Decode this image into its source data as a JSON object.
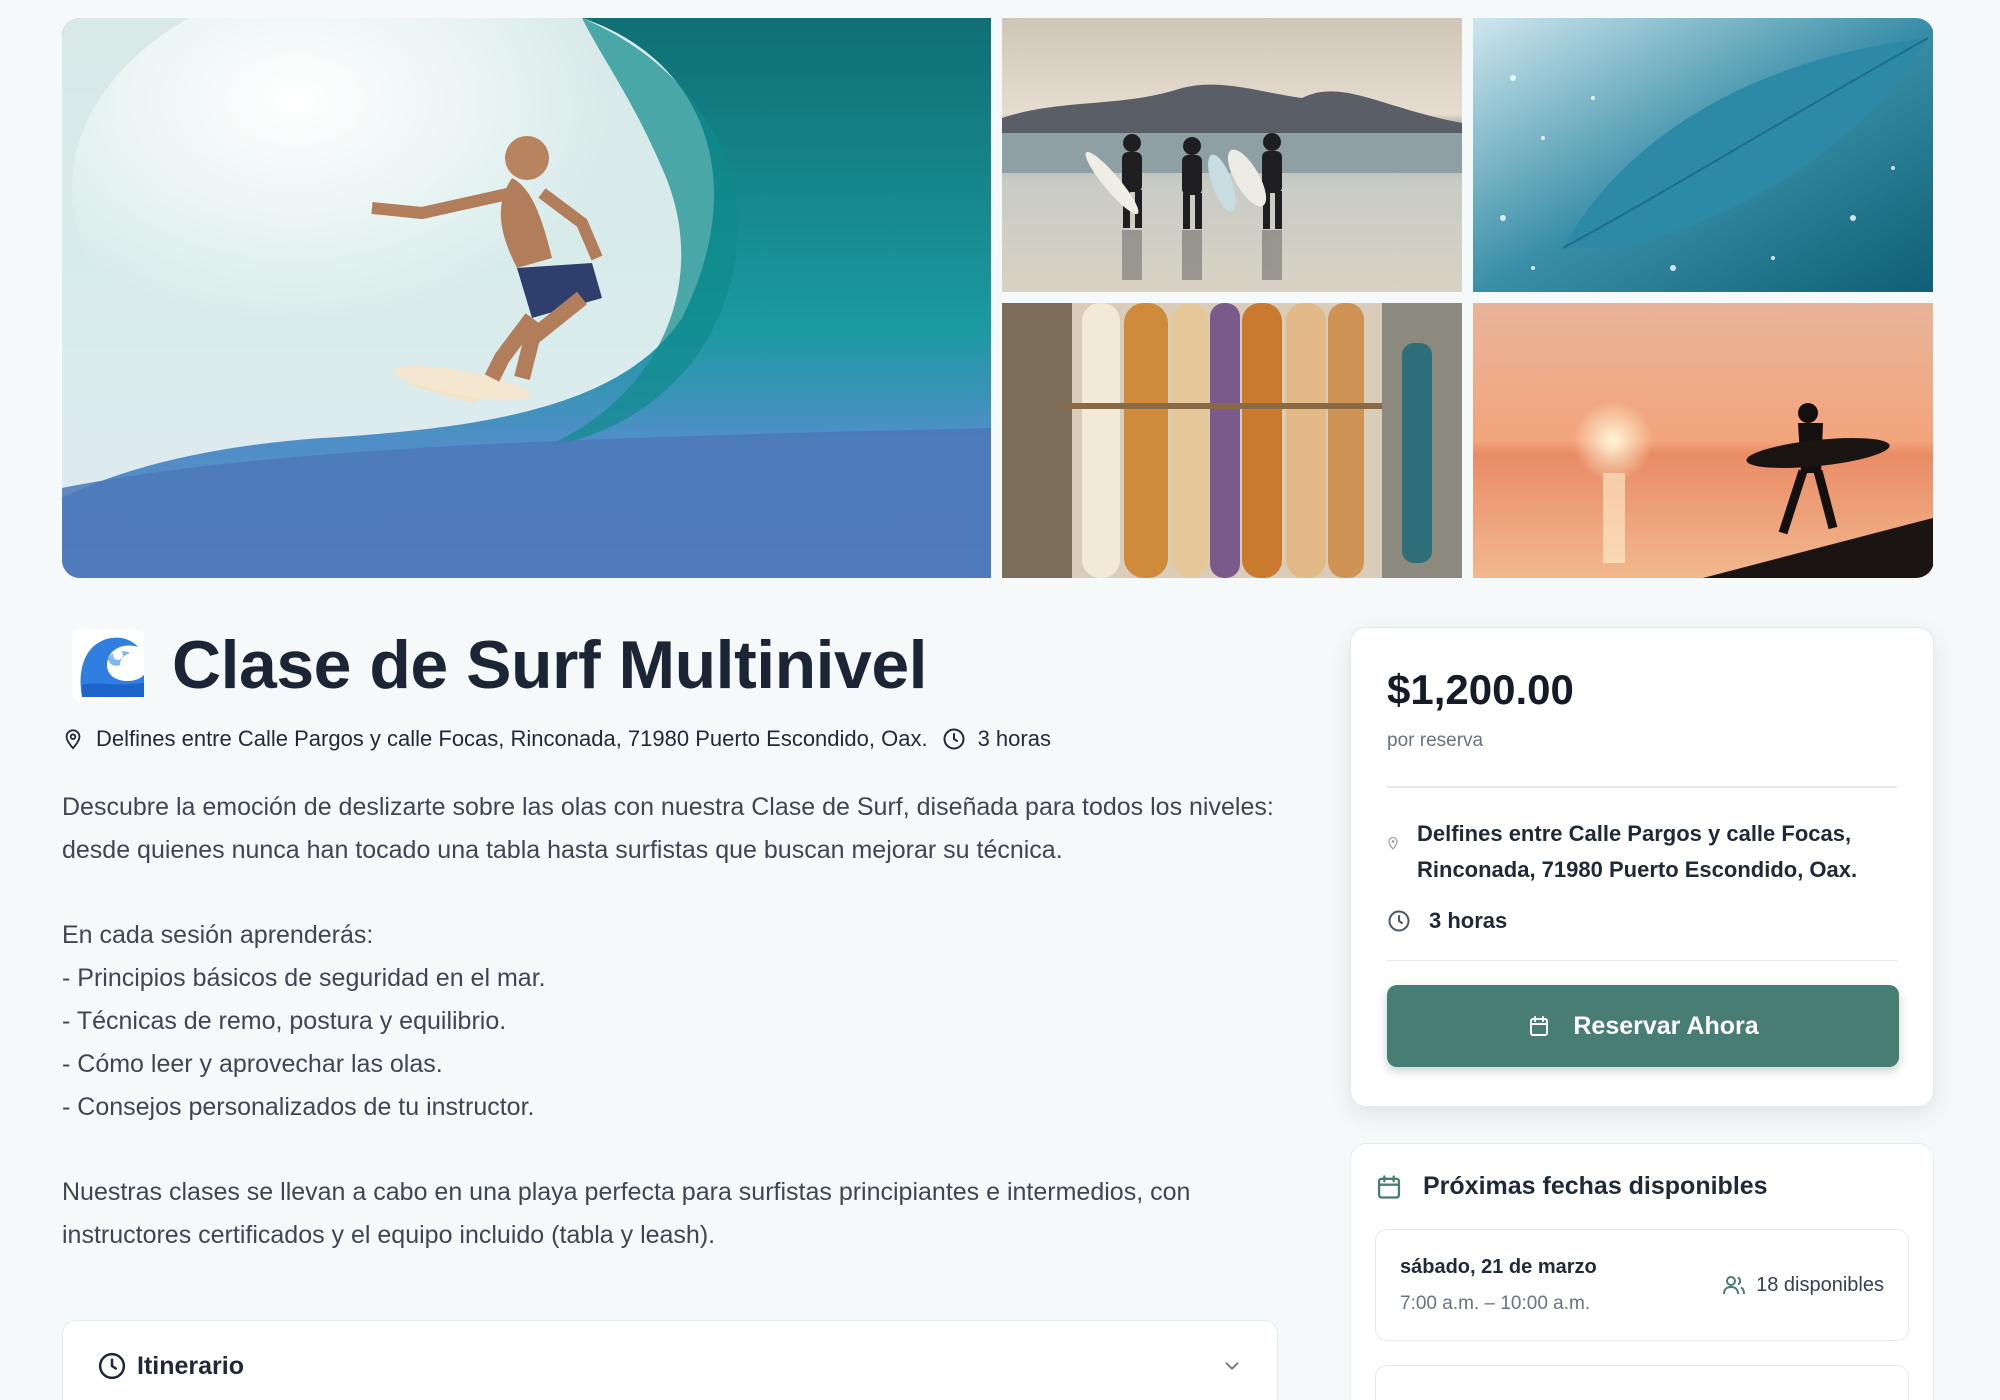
{
  "gallery": {
    "photos": [
      {
        "name": "photo-surfer-wave",
        "desc": "surfer riding inside a turquoise wave"
      },
      {
        "name": "photo-three-surfers-beach"
      },
      {
        "name": "photo-surfboard-spray"
      },
      {
        "name": "photo-surfboards-rack"
      },
      {
        "name": "photo-sunset-surfer"
      }
    ]
  },
  "activity": {
    "title": "Clase de Surf Multinivel",
    "address": "Delfines entre Calle Pargos y calle Focas, Rinconada, 71980 Puerto Escondido, Oax.",
    "duration": "3 horas",
    "description": {
      "intro": "Descubre la emoción de deslizarte sobre las olas con nuestra Clase de Surf, diseñada para todos los niveles: desde quienes nunca han tocado una tabla hasta surfistas que buscan mejorar su técnica.",
      "list_title": "En cada sesión aprenderás:",
      "items": [
        "- Principios básicos de seguridad en el mar.",
        "- Técnicas de remo, postura y equilibrio.",
        "- Cómo leer y aprovechar las olas.",
        "- Consejos personalizados de tu instructor."
      ],
      "closing": "Nuestras clases se llevan a cabo en una playa perfecta para surfistas principiantes e intermedios, con instructores certificados y el equipo incluido (tabla y leash)."
    },
    "itinerary_label": "Itinerario"
  },
  "booking": {
    "price": "$1,200.00",
    "per": "por reserva",
    "address": "Delfines entre Calle Pargos y calle Focas, Rinconada, 71980 Puerto Escondido, Oax.",
    "duration": "3 horas",
    "button_label": "Reservar Ahora",
    "accent": "#477d72"
  },
  "dates": {
    "title": "Próximas fechas disponibles",
    "items": [
      {
        "day": "sábado, 21 de marzo",
        "time": "7:00 a.m. – 10:00 a.m.",
        "available": "18 disponibles"
      }
    ]
  }
}
